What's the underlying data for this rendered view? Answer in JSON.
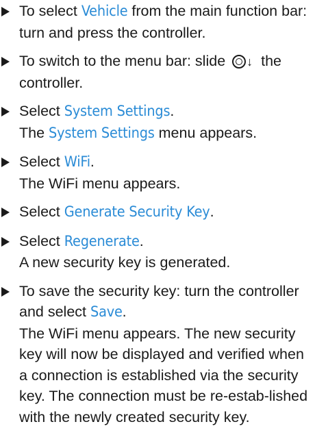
{
  "steps": [
    {
      "pre": "To select ",
      "ui1": "Vehicle",
      "mid": " from the main function bar: turn and press the controller."
    },
    {
      "pre": "To switch to the menu bar: slide ",
      "arrow": "↓",
      "post": " the controller."
    },
    {
      "pre": "Select ",
      "ui1": "System Settings",
      "post": ".",
      "result_pre": "The ",
      "result_ui": "System Settings",
      "result_post": " menu appears."
    },
    {
      "pre": "Select ",
      "ui1": "WiFi",
      "post": ".",
      "result": "The WiFi menu appears."
    },
    {
      "pre": "Select ",
      "ui1": "Generate Security Key",
      "post": "."
    },
    {
      "pre": "Select ",
      "ui1": "Regenerate",
      "post": ".",
      "result": "A new security key is generated."
    },
    {
      "pre": "To save the security key: turn the controller and select ",
      "ui1": "Save",
      "post": ".",
      "result": "The WiFi menu appears. The new security key will now be displayed and verified when a connection is established via the security key. The connection must be re-estab-lished with the newly created security key."
    }
  ],
  "colors": {
    "text": "#1a1a1a",
    "ui_term": "#2a8bd6"
  },
  "icons": {
    "bullet": "triangle-right-icon",
    "controller": "controller-knob-icon"
  }
}
